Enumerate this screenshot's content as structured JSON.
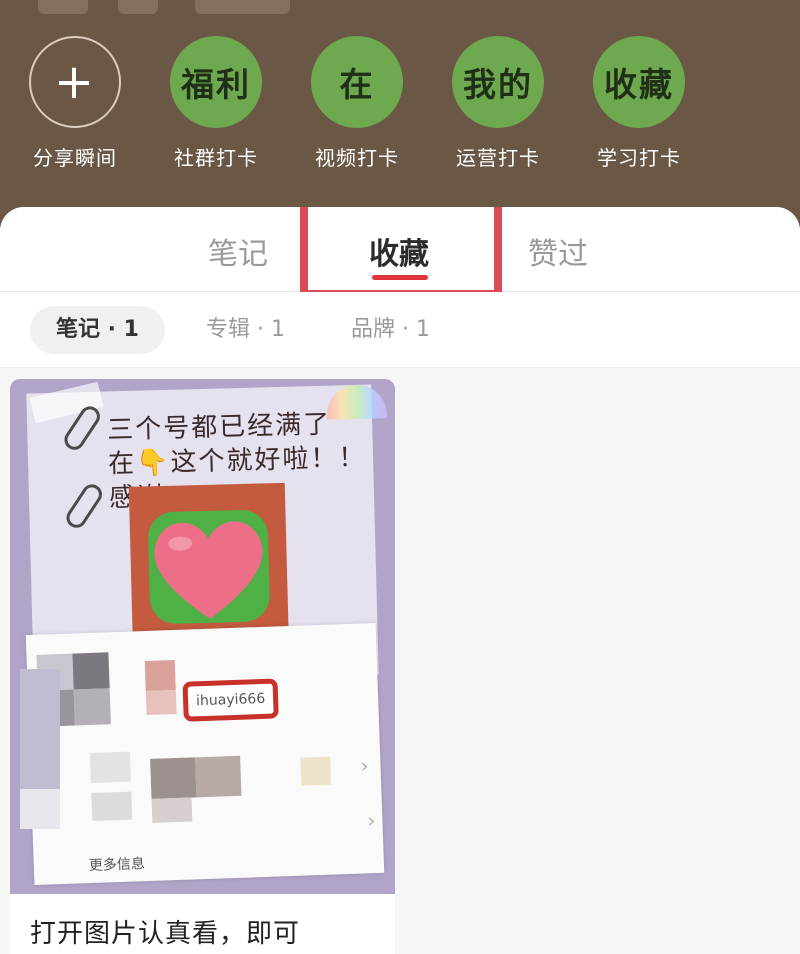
{
  "circles": [
    {
      "label": "分享瞬间",
      "text": "+",
      "icon": "plus-icon"
    },
    {
      "label": "社群打卡",
      "text": "福利"
    },
    {
      "label": "视频打卡",
      "text": "在"
    },
    {
      "label": "运营打卡",
      "text": "我的"
    },
    {
      "label": "学习打卡",
      "text": "收藏"
    }
  ],
  "tabs": {
    "notes": "笔记",
    "collect": "收藏",
    "liked": "赞过",
    "active": "收藏"
  },
  "subtabs": {
    "notes": "笔记 · 1",
    "albums": "专辑 · 1",
    "brands": "品牌 · 1",
    "active": "笔记 · 1"
  },
  "card": {
    "note_lines": [
      "三个号都已经满了",
      "在👇这个就好啦！！",
      "感谢"
    ],
    "handle": "ihuayi666",
    "more_info": "更多信息",
    "title": "打开图片认真看，即可"
  },
  "colors": {
    "header_bg": "#6b5745",
    "circle_green": "#6fa94f",
    "active_underline": "#e0353b",
    "highlight_frame": "#d94c56"
  }
}
